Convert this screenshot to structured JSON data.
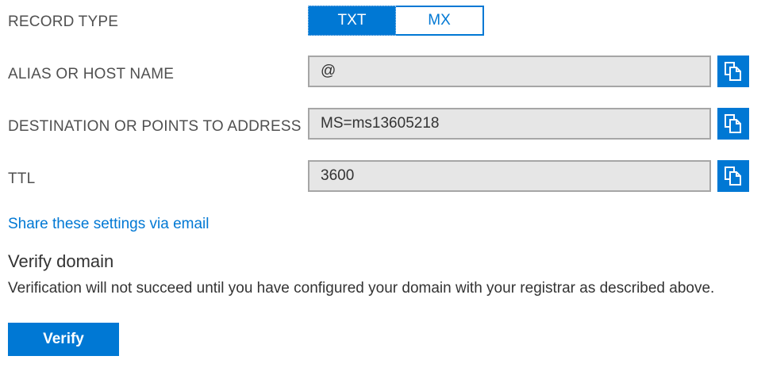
{
  "record_type": {
    "label": "RECORD TYPE",
    "options": [
      "TXT",
      "MX"
    ],
    "selected": "TXT"
  },
  "alias": {
    "label": "ALIAS OR HOST NAME",
    "value": "@"
  },
  "destination": {
    "label": "DESTINATION OR POINTS TO ADDRESS",
    "value": "MS=ms13605218"
  },
  "ttl": {
    "label": "TTL",
    "value": "3600"
  },
  "share_link": "Share these settings via email",
  "verify": {
    "heading": "Verify domain",
    "description": "Verification will not succeed until you have configured your domain with your registrar as described above.",
    "button_label": "Verify"
  },
  "colors": {
    "accent": "#0078d4",
    "field_bg": "#e6e6e6",
    "field_border": "#a6a6a6"
  },
  "icons": {
    "copy": "copy-icon"
  }
}
